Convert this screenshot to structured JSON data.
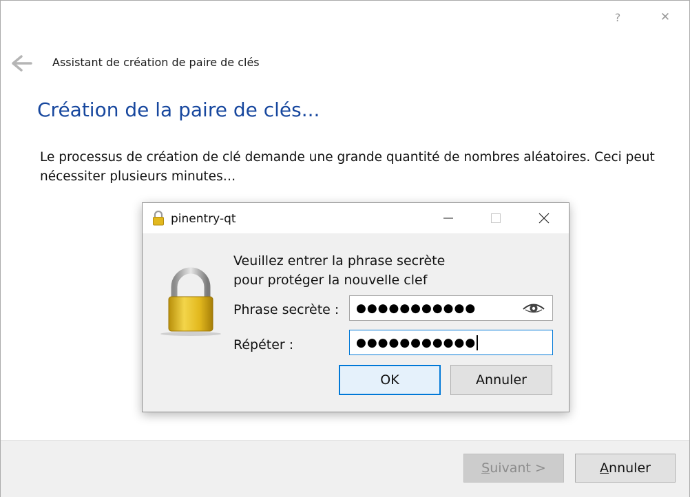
{
  "window": {
    "help_label": "?",
    "close_label": "✕",
    "title": "Assistant de création de paire de clés"
  },
  "page": {
    "heading": "Création de la paire de clés...",
    "description": "Le processus de création de clé demande une grande quantité de nombres aléatoires. Ceci peut nécessiter plusieurs minutes…"
  },
  "footer": {
    "next_label": "Suivant >",
    "cancel_label": "Annuler"
  },
  "dialog": {
    "title": "pinentry-qt",
    "prompt_line1": "Veuillez entrer la phrase secrète",
    "prompt_line2": "pour protéger la nouvelle clef",
    "passphrase_label": "Phrase secrète :",
    "passphrase_value": "●●●●●●●●●●●",
    "repeat_label": "Répéter :",
    "repeat_value": "●●●●●●●●●●●",
    "ok_label": "OK",
    "cancel_label": "Annuler"
  },
  "icons": {
    "back": "arrow-left-icon",
    "help": "help-icon",
    "close": "close-icon",
    "lock": "padlock-icon",
    "eye": "eye-icon",
    "minimize": "minimize-icon",
    "maximize": "maximize-icon"
  },
  "colors": {
    "heading": "#17479e",
    "focus": "#0078d7",
    "lock_gold": "#e2b81e"
  }
}
